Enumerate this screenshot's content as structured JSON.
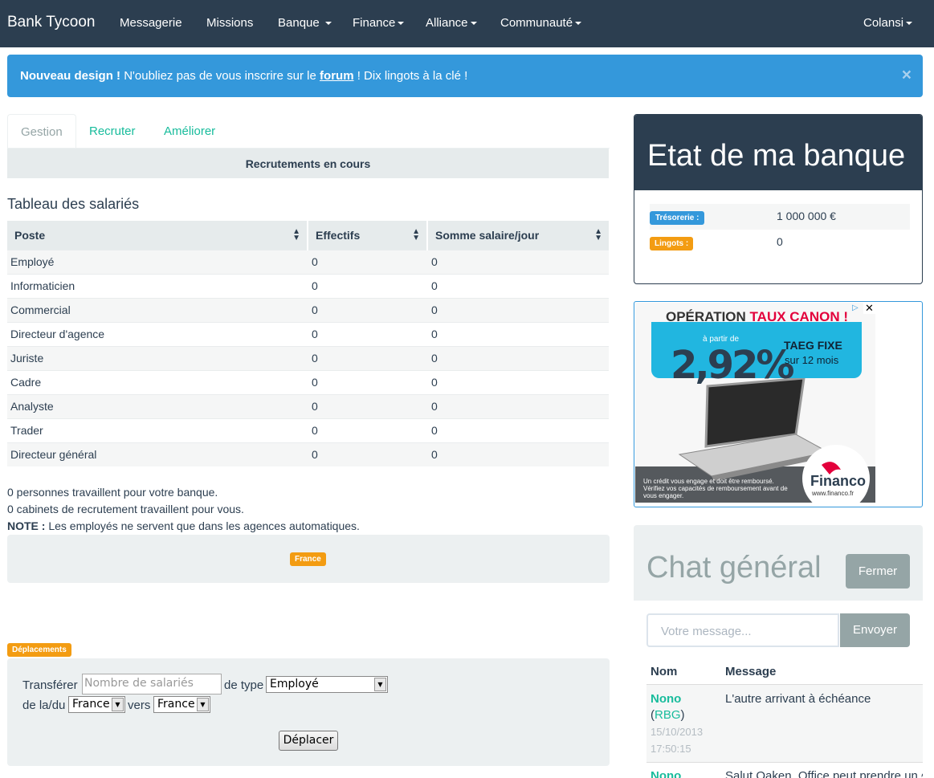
{
  "navbar": {
    "brand": "Bank Tycoon",
    "items": [
      {
        "label": "Messagerie"
      },
      {
        "label": "Missions"
      },
      {
        "label": "Banque"
      },
      {
        "label": "Finance"
      },
      {
        "label": "Alliance"
      },
      {
        "label": "Communauté"
      }
    ],
    "user": "Colansi"
  },
  "alert": {
    "bold": "Nouveau design !",
    "text1": "N'oubliez pas de vous inscrire sur le",
    "link": "forum",
    "text2": "! Dix lingots à la clé !",
    "close": "×"
  },
  "tabs": [
    "Gestion",
    "Recruter",
    "Améliorer"
  ],
  "recruitments_bar": "Recrutements en cours",
  "section_title": "Tableau des salariés",
  "table": {
    "headers": [
      "Poste",
      "Effectifs",
      "Somme salaire/jour"
    ],
    "rows": [
      [
        "Employé",
        "0",
        "0"
      ],
      [
        "Informaticien",
        "0",
        "0"
      ],
      [
        "Commercial",
        "0",
        "0"
      ],
      [
        "Directeur d'agence",
        "0",
        "0"
      ],
      [
        "Juriste",
        "0",
        "0"
      ],
      [
        "Cadre",
        "0",
        "0"
      ],
      [
        "Analyste",
        "0",
        "0"
      ],
      [
        "Trader",
        "0",
        "0"
      ],
      [
        "Directeur général",
        "0",
        "0"
      ]
    ]
  },
  "info": {
    "line1": "0 personnes travaillent pour votre banque.",
    "line2": "0 cabinets de recrutement travaillent pour vous.",
    "note_label": "NOTE :",
    "note_text": "Les employés ne servent que dans les agences automatiques."
  },
  "region_label": "France",
  "moves": {
    "label": "Déplacements",
    "transfer": "Transférer",
    "placeholder": "Nombre de salariés",
    "of_type": "de type",
    "type_value": "Employé",
    "from": "de la/du",
    "from_value": "France",
    "to": "vers",
    "to_value": "France",
    "button": "Déplacer"
  },
  "bank_state": {
    "title": "Etat de ma banque",
    "treasury_label": "Trésorerie :",
    "treasury_value": "1 000 000 €",
    "ingots_label": "Lingots :",
    "ingots_value": "0"
  },
  "ad": {
    "title_a": "OPÉRATION",
    "title_b": "TAUX CANON !",
    "from": "à partir de",
    "rate": "2,92%",
    "taeg": "TAEG FIXE",
    "months": "sur 12 mois",
    "fine": "Un crédit vous engage et doit être remboursé. Vérifiez vos capacités de remboursement avant de vous engager.",
    "logo": "Financo",
    "url": "www.financo.fr"
  },
  "chat": {
    "title": "Chat général",
    "close_button": "Fermer",
    "placeholder": "Votre message...",
    "send_button": "Envoyer",
    "col_name": "Nom",
    "col_message": "Message",
    "messages": [
      {
        "user": "Nono",
        "alliance": "RBG",
        "date": "15/10/2013 17:50:15",
        "text": "L'autre arrivant à échéance"
      },
      {
        "user": "Nono",
        "alliance": "",
        "date": "",
        "text": "Salut Oaken. Office peut prendre un des"
      }
    ]
  },
  "colors": {
    "navbar": "#2c3e50",
    "alert": "#3498db",
    "accent": "#18bc9c",
    "warning": "#f39c12",
    "muted": "#95a5a6"
  }
}
